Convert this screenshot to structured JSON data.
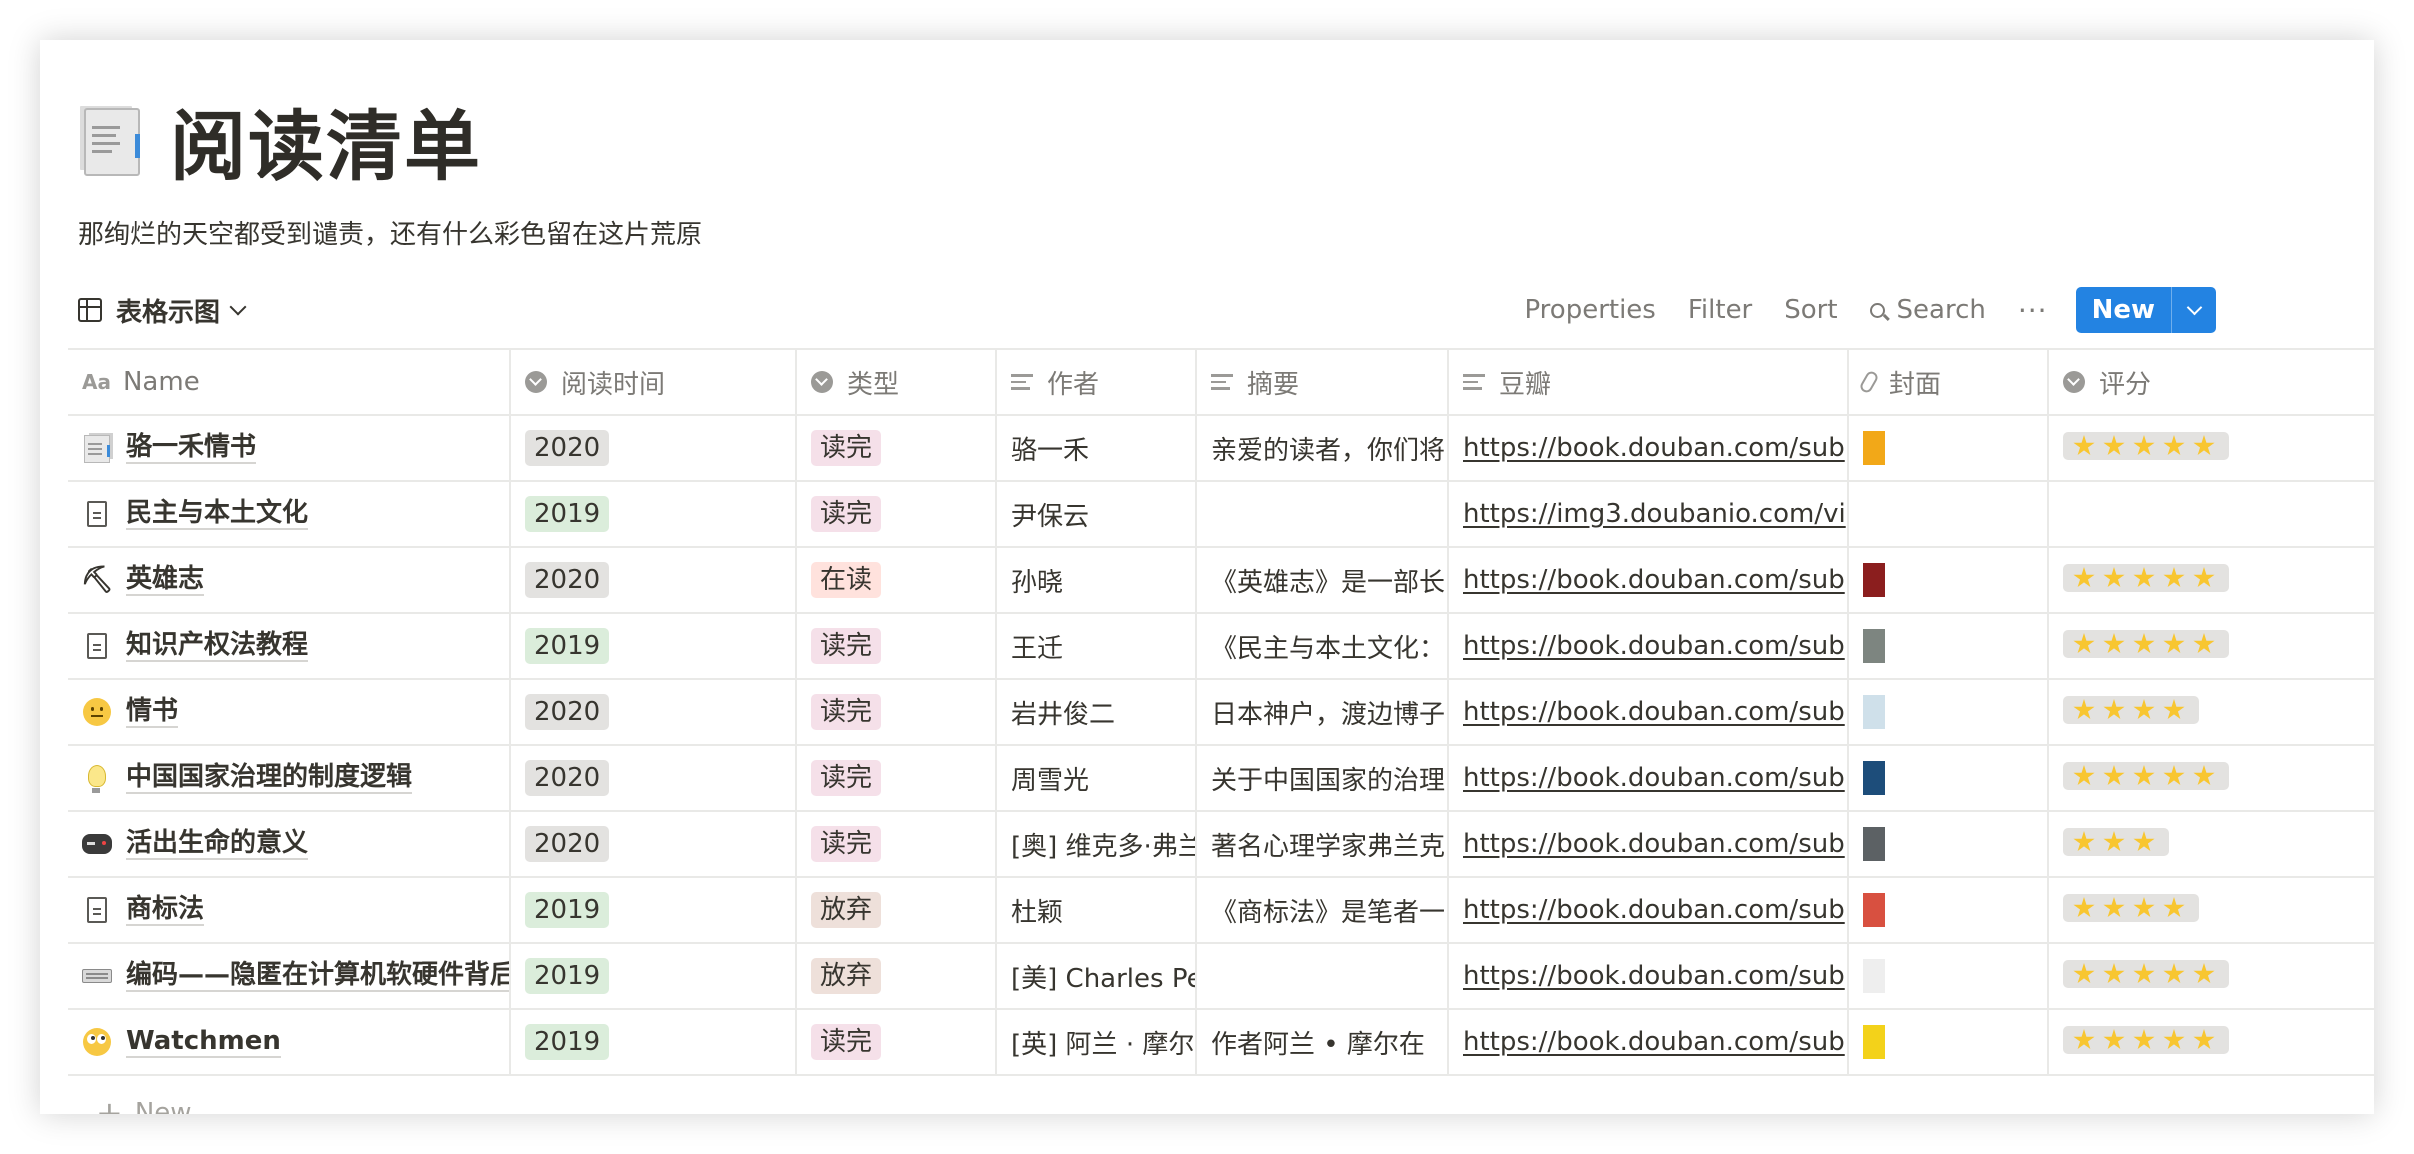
{
  "page": {
    "title": "阅读清单",
    "description": "那绚烂的天空都受到谴责，还有什么彩色留在这片荒原"
  },
  "view": {
    "name": "表格示图"
  },
  "toolbar": {
    "properties": "Properties",
    "filter": "Filter",
    "sort": "Sort",
    "search": "Search",
    "more": "···",
    "new": "New"
  },
  "columns": {
    "name": "Name",
    "time": "阅读时间",
    "type": "类型",
    "author": "作者",
    "summary": "摘要",
    "douban": "豆瓣",
    "cover": "封面",
    "rating": "评分"
  },
  "rows": [
    {
      "icon": "document-book-icon",
      "name": "骆一禾情书",
      "year": "2020",
      "status": "读完",
      "author": "骆一禾",
      "summary": "亲爱的读者，你们将",
      "url": "https://book.douban.com/sub",
      "cover_color": "#f2a818",
      "rating": 5
    },
    {
      "icon": "page-icon",
      "name": "民主与本土文化",
      "year": "2019",
      "status": "读完",
      "author": "尹保云",
      "summary": "",
      "url": "https://img3.doubanio.com/vi",
      "cover_color": "",
      "rating": 0
    },
    {
      "icon": "pick-icon",
      "name": "英雄志",
      "year": "2020",
      "status": "在读",
      "author": "孙晓",
      "summary": "《英雄志》是一部长",
      "url": "https://book.douban.com/sub",
      "cover_color": "#8b1e1e",
      "rating": 5
    },
    {
      "icon": "page-icon",
      "name": "知识产权法教程",
      "year": "2019",
      "status": "读完",
      "author": "王迁",
      "summary": "《民主与本土文化：",
      "url": "https://book.douban.com/sub",
      "cover_color": "#7d8580",
      "rating": 5
    },
    {
      "icon": "smile-icon",
      "name": "情书",
      "year": "2020",
      "status": "读完",
      "author": "岩井俊二",
      "summary": "日本神户，渡边博子",
      "url": "https://book.douban.com/sub",
      "cover_color": "#cfe0ea",
      "rating": 4
    },
    {
      "icon": "bulb-icon",
      "name": "中国国家治理的制度逻辑",
      "year": "2020",
      "status": "读完",
      "author": "周雪光",
      "summary": "关于中国国家的治理",
      "url": "https://book.douban.com/sub",
      "cover_color": "#1d4d7a",
      "rating": 5
    },
    {
      "icon": "gamepad-icon",
      "name": "活出生命的意义",
      "year": "2020",
      "status": "读完",
      "author": "[奥] 维克多·弗兰",
      "summary": "著名心理学家弗兰克",
      "url": "https://book.douban.com/sub",
      "cover_color": "#5c6164",
      "rating": 3
    },
    {
      "icon": "page-icon",
      "name": "商标法",
      "year": "2019",
      "status": "放弃",
      "author": "杜颖",
      "summary": "《商标法》是笔者一",
      "url": "https://book.douban.com/sub",
      "cover_color": "#d85040",
      "rating": 4
    },
    {
      "icon": "keyboard-icon",
      "name": "编码——隐匿在计算机软硬件背后的语言",
      "year": "2019",
      "status": "放弃",
      "author": "[美] Charles Pe",
      "summary": "",
      "url": "https://book.douban.com/sub",
      "cover_color": "#eeeeee",
      "rating": 5
    },
    {
      "icon": "rolling-eyes-icon",
      "name": "Watchmen",
      "year": "2019",
      "status": "读完",
      "author": "[英] 阿兰 · 摩尔",
      "summary": "作者阿兰 • 摩尔在",
      "url": "https://book.douban.com/sub",
      "cover_color": "#f3d21a",
      "rating": 5
    }
  ],
  "add_row": "New",
  "colors": {
    "accent": "#2383e2",
    "tag_2020": "#e3e2e0",
    "tag_2019": "#dbeddb",
    "tag_done": "#f5e0e9",
    "tag_reading": "#ffe2dd",
    "tag_dropped": "#eee0da",
    "star": "#f8c630"
  }
}
